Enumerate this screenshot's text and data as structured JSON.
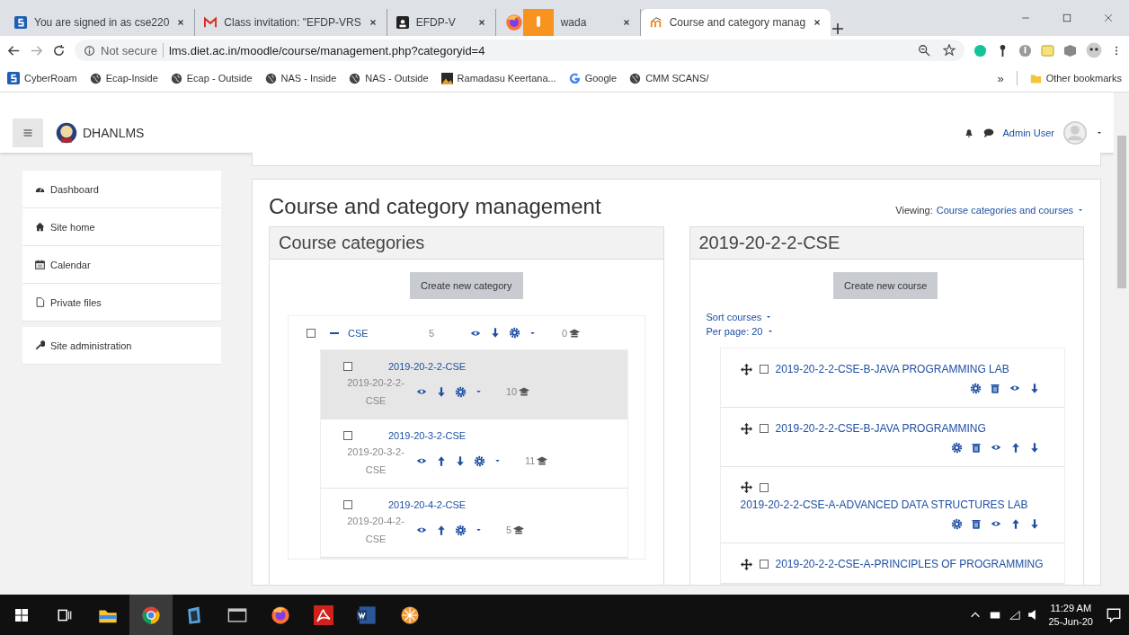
{
  "browser": {
    "tabs": [
      {
        "title": "You are signed in as cse220",
        "selected": false
      },
      {
        "title": "Class invitation: \"EFDP-VRS",
        "selected": false
      },
      {
        "title": "EFDP-V",
        "selected": false
      },
      {
        "title": "wada",
        "selected": false
      },
      {
        "title": "Course and category manag",
        "selected": true
      }
    ],
    "address": {
      "security": "Not secure",
      "url": "lms.diet.ac.in/moodle/course/management.php?categoryid=4"
    },
    "bookmarks": [
      "CyberRoam",
      "Ecap-Inside",
      "Ecap - Outside",
      "NAS - Inside",
      "NAS - Outside",
      "Ramadasu Keertana...",
      "Google",
      "CMM SCANS/"
    ],
    "more_bookmarks": "»",
    "other_bookmarks": "Other bookmarks"
  },
  "navbar": {
    "site_name": "DHANLMS",
    "user": "Admin User"
  },
  "sidebar": {
    "items": [
      "Dashboard",
      "Site home",
      "Calendar",
      "Private files"
    ],
    "admin_items": [
      "Site administration"
    ]
  },
  "page": {
    "title": "Course and category management",
    "viewing_label": "Viewing:",
    "viewing_value": "Course categories and courses"
  },
  "categories_panel": {
    "heading": "Course categories",
    "create_button": "Create new category",
    "tree": [
      {
        "name": "CSE",
        "idnumber": "5",
        "course_count": "0",
        "expanded": true,
        "checked": false,
        "selected": false,
        "move_up": false,
        "move_down": true,
        "children": [
          {
            "name": "2019-20-2-2-CSE",
            "idnumber": "2019-20-2-2-CSE",
            "course_count": "10",
            "checked": false,
            "selected": true,
            "move_up": false,
            "move_down": true
          },
          {
            "name": "2019-20-3-2-CSE",
            "idnumber": "2019-20-3-2-CSE",
            "course_count": "11",
            "checked": false,
            "selected": false,
            "move_up": true,
            "move_down": true
          },
          {
            "name": "2019-20-4-2-CSE",
            "idnumber": "2019-20-4-2-CSE",
            "course_count": "5",
            "checked": false,
            "selected": false,
            "move_up": true,
            "move_down": false
          }
        ]
      }
    ]
  },
  "courses_panel": {
    "heading": "2019-20-2-2-CSE",
    "create_button": "Create new course",
    "sort_label": "Sort courses",
    "per_page": "Per page: 20",
    "courses": [
      {
        "name": "2019-20-2-2-CSE-B-JAVA PROGRAMMING LAB",
        "checked": false,
        "move_up": false,
        "move_down": true
      },
      {
        "name": "2019-20-2-2-CSE-B-JAVA PROGRAMMING",
        "checked": false,
        "move_up": true,
        "move_down": true
      },
      {
        "name": "2019-20-2-2-CSE-A-ADVANCED DATA STRUCTURES LAB",
        "checked": false,
        "move_up": true,
        "move_down": true
      },
      {
        "name": "2019-20-2-2-CSE-A-PRINCIPLES OF PROGRAMMING",
        "checked": false
      }
    ]
  },
  "taskbar": {
    "apps": [
      {
        "selected": false
      },
      {
        "selected": false
      },
      {
        "selected": true
      },
      {
        "selected": false
      },
      {
        "selected": false
      },
      {
        "selected": false
      },
      {
        "selected": false
      },
      {
        "selected": false
      },
      {
        "selected": false
      }
    ],
    "time": "11:29 AM",
    "date": "25-Jun-20"
  }
}
